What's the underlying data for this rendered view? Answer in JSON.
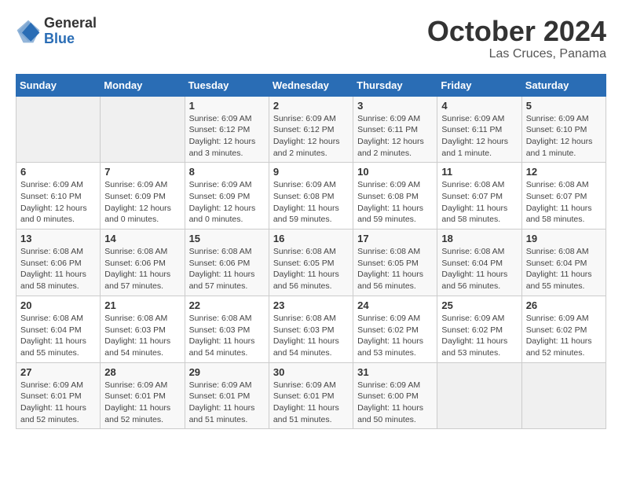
{
  "header": {
    "logo_general": "General",
    "logo_blue": "Blue",
    "month": "October 2024",
    "location": "Las Cruces, Panama"
  },
  "weekdays": [
    "Sunday",
    "Monday",
    "Tuesday",
    "Wednesday",
    "Thursday",
    "Friday",
    "Saturday"
  ],
  "weeks": [
    [
      {
        "day": "",
        "detail": ""
      },
      {
        "day": "",
        "detail": ""
      },
      {
        "day": "1",
        "detail": "Sunrise: 6:09 AM\nSunset: 6:12 PM\nDaylight: 12 hours and 3 minutes."
      },
      {
        "day": "2",
        "detail": "Sunrise: 6:09 AM\nSunset: 6:12 PM\nDaylight: 12 hours and 2 minutes."
      },
      {
        "day": "3",
        "detail": "Sunrise: 6:09 AM\nSunset: 6:11 PM\nDaylight: 12 hours and 2 minutes."
      },
      {
        "day": "4",
        "detail": "Sunrise: 6:09 AM\nSunset: 6:11 PM\nDaylight: 12 hours and 1 minute."
      },
      {
        "day": "5",
        "detail": "Sunrise: 6:09 AM\nSunset: 6:10 PM\nDaylight: 12 hours and 1 minute."
      }
    ],
    [
      {
        "day": "6",
        "detail": "Sunrise: 6:09 AM\nSunset: 6:10 PM\nDaylight: 12 hours and 0 minutes."
      },
      {
        "day": "7",
        "detail": "Sunrise: 6:09 AM\nSunset: 6:09 PM\nDaylight: 12 hours and 0 minutes."
      },
      {
        "day": "8",
        "detail": "Sunrise: 6:09 AM\nSunset: 6:09 PM\nDaylight: 12 hours and 0 minutes."
      },
      {
        "day": "9",
        "detail": "Sunrise: 6:09 AM\nSunset: 6:08 PM\nDaylight: 11 hours and 59 minutes."
      },
      {
        "day": "10",
        "detail": "Sunrise: 6:09 AM\nSunset: 6:08 PM\nDaylight: 11 hours and 59 minutes."
      },
      {
        "day": "11",
        "detail": "Sunrise: 6:08 AM\nSunset: 6:07 PM\nDaylight: 11 hours and 58 minutes."
      },
      {
        "day": "12",
        "detail": "Sunrise: 6:08 AM\nSunset: 6:07 PM\nDaylight: 11 hours and 58 minutes."
      }
    ],
    [
      {
        "day": "13",
        "detail": "Sunrise: 6:08 AM\nSunset: 6:06 PM\nDaylight: 11 hours and 58 minutes."
      },
      {
        "day": "14",
        "detail": "Sunrise: 6:08 AM\nSunset: 6:06 PM\nDaylight: 11 hours and 57 minutes."
      },
      {
        "day": "15",
        "detail": "Sunrise: 6:08 AM\nSunset: 6:06 PM\nDaylight: 11 hours and 57 minutes."
      },
      {
        "day": "16",
        "detail": "Sunrise: 6:08 AM\nSunset: 6:05 PM\nDaylight: 11 hours and 56 minutes."
      },
      {
        "day": "17",
        "detail": "Sunrise: 6:08 AM\nSunset: 6:05 PM\nDaylight: 11 hours and 56 minutes."
      },
      {
        "day": "18",
        "detail": "Sunrise: 6:08 AM\nSunset: 6:04 PM\nDaylight: 11 hours and 56 minutes."
      },
      {
        "day": "19",
        "detail": "Sunrise: 6:08 AM\nSunset: 6:04 PM\nDaylight: 11 hours and 55 minutes."
      }
    ],
    [
      {
        "day": "20",
        "detail": "Sunrise: 6:08 AM\nSunset: 6:04 PM\nDaylight: 11 hours and 55 minutes."
      },
      {
        "day": "21",
        "detail": "Sunrise: 6:08 AM\nSunset: 6:03 PM\nDaylight: 11 hours and 54 minutes."
      },
      {
        "day": "22",
        "detail": "Sunrise: 6:08 AM\nSunset: 6:03 PM\nDaylight: 11 hours and 54 minutes."
      },
      {
        "day": "23",
        "detail": "Sunrise: 6:08 AM\nSunset: 6:03 PM\nDaylight: 11 hours and 54 minutes."
      },
      {
        "day": "24",
        "detail": "Sunrise: 6:09 AM\nSunset: 6:02 PM\nDaylight: 11 hours and 53 minutes."
      },
      {
        "day": "25",
        "detail": "Sunrise: 6:09 AM\nSunset: 6:02 PM\nDaylight: 11 hours and 53 minutes."
      },
      {
        "day": "26",
        "detail": "Sunrise: 6:09 AM\nSunset: 6:02 PM\nDaylight: 11 hours and 52 minutes."
      }
    ],
    [
      {
        "day": "27",
        "detail": "Sunrise: 6:09 AM\nSunset: 6:01 PM\nDaylight: 11 hours and 52 minutes."
      },
      {
        "day": "28",
        "detail": "Sunrise: 6:09 AM\nSunset: 6:01 PM\nDaylight: 11 hours and 52 minutes."
      },
      {
        "day": "29",
        "detail": "Sunrise: 6:09 AM\nSunset: 6:01 PM\nDaylight: 11 hours and 51 minutes."
      },
      {
        "day": "30",
        "detail": "Sunrise: 6:09 AM\nSunset: 6:01 PM\nDaylight: 11 hours and 51 minutes."
      },
      {
        "day": "31",
        "detail": "Sunrise: 6:09 AM\nSunset: 6:00 PM\nDaylight: 11 hours and 50 minutes."
      },
      {
        "day": "",
        "detail": ""
      },
      {
        "day": "",
        "detail": ""
      }
    ]
  ]
}
